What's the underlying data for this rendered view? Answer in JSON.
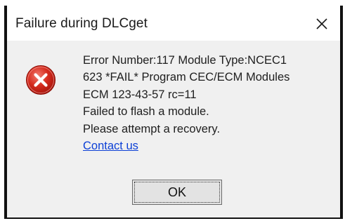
{
  "dialog": {
    "title": "Failure during DLCget",
    "close_glyph": "✕",
    "icon": "error-icon",
    "message_lines": [
      "Error Number:117 Module Type:NCEC1",
      "623 *FAIL* Program CEC/ECM Modules",
      "ECM 123-43-57 rc=11",
      "Failed to flash a module.",
      "Please attempt a recovery."
    ],
    "link_text": "Contact us",
    "ok_label": "OK"
  },
  "colors": {
    "title_bg": "#ffffff",
    "body_bg": "#f0f0f0",
    "error_red": "#d52b1e",
    "link_blue": "#0b3fd6"
  }
}
